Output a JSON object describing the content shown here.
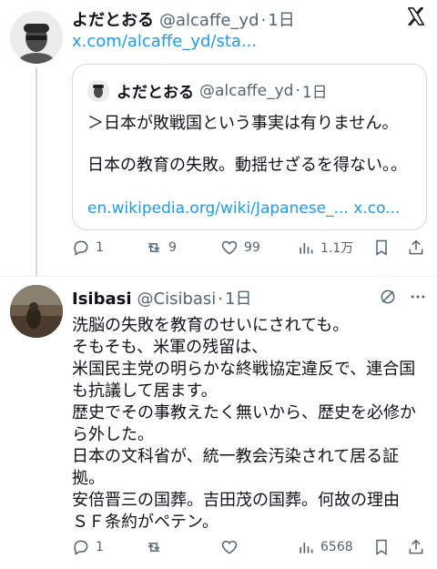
{
  "tweet1": {
    "name": "よだとおる",
    "handle": "@alcaffe_yd",
    "time": "1日",
    "link": "x.com/alcaffe_yd/sta...",
    "quote": {
      "name": "よだとおる",
      "handle": "@alcaffe_yd",
      "time": "1日",
      "line1": "＞日本が敗戦国という事実は有りません。",
      "line2": "日本の教育の失敗。動揺せざるを得ない。。",
      "link": "en.wikipedia.org/wiki/Japanese_... x.co..."
    },
    "actions": {
      "replies": "1",
      "reposts": "9",
      "likes": "99",
      "views": "1.1万"
    }
  },
  "tweet2": {
    "name": "Isibasi",
    "handle": "@Cisibasi",
    "time": "1日",
    "lines": [
      "洗脳の失敗を教育のせいにされても。",
      "そもそも、米軍の残留は、",
      "米国民主党の明らかな終戦協定違反で、連合国",
      "も抗議して居ます。",
      "歴史でその事教えたく無いから、歴史を必修か",
      "ら外した。",
      "日本の文科省が、統一教会汚染されて居る証",
      "拠。",
      "安倍晋三の国葬。吉田茂の国葬。何故の理由",
      "ＳＦ条約がペテン。"
    ],
    "actions": {
      "replies": "1",
      "views": "6568"
    }
  },
  "icons": {
    "logo": "x-logo-icon",
    "reply": "reply-icon",
    "repost": "repost-icon",
    "like": "heart-icon",
    "views": "views-icon",
    "bookmark": "bookmark-icon",
    "share": "share-icon",
    "grok": "grok-icon",
    "more": "more-icon"
  },
  "colors": {
    "link": "#1d9bf0",
    "secondary": "#536471",
    "text": "#0f1419",
    "border": "#cfd9de"
  }
}
